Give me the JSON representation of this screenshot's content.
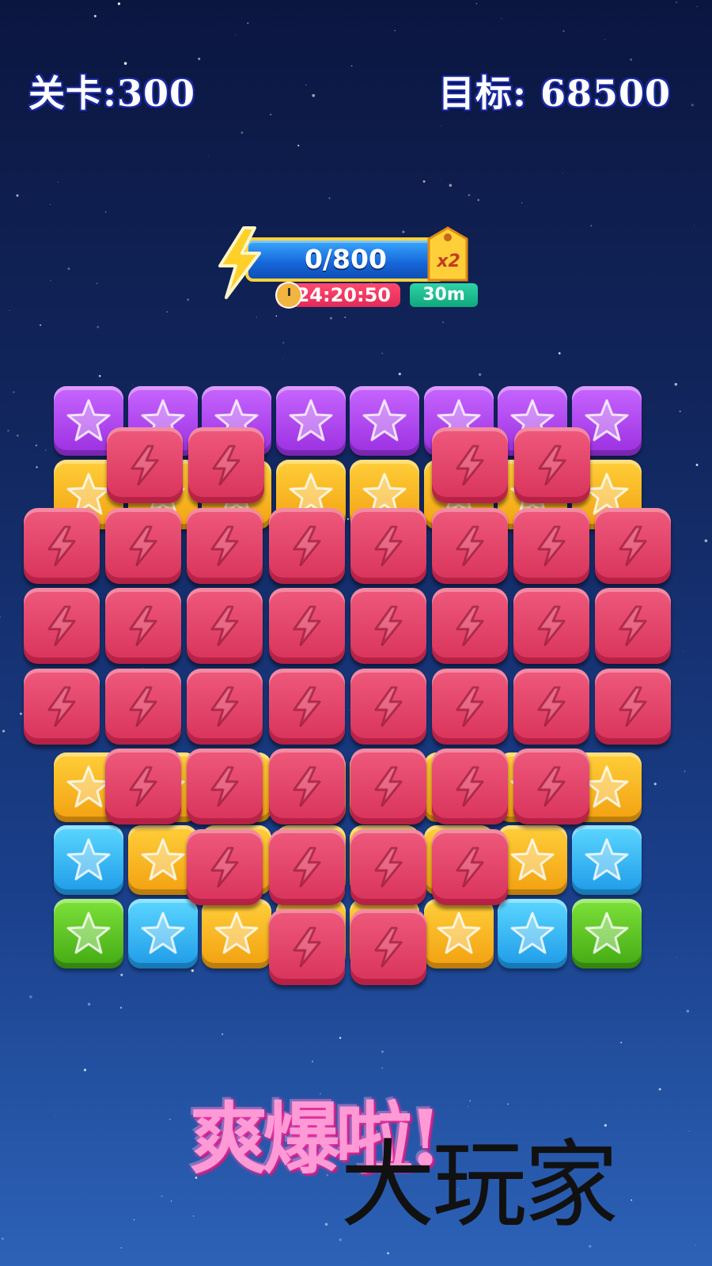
{
  "hud": {
    "level_text": "关卡:300",
    "target_text": "目标: 68500"
  },
  "energy": {
    "progress_text": "0/800",
    "progress_fraction": 0,
    "multiplier": "x2",
    "timer": "24:20:50",
    "duration": "30m",
    "icons": [
      "lightning-bolt-icon",
      "price-tag-icon",
      "clock-icon"
    ]
  },
  "board": {
    "columns": 8,
    "background_rows": [
      [
        "purple",
        "purple",
        "purple",
        "purple",
        "purple",
        "purple",
        "purple",
        "purple"
      ],
      [
        "orange",
        "orange",
        "orange",
        "orange",
        "orange",
        "orange",
        "orange",
        "orange"
      ],
      [
        "",
        "",
        "",
        "",
        "",
        "",
        "",
        ""
      ],
      [
        "",
        "",
        "",
        "",
        "",
        "",
        "",
        ""
      ],
      [
        "",
        "",
        "",
        "",
        "",
        "",
        "",
        ""
      ],
      [
        "orange",
        "orange",
        "orange",
        "orange",
        "orange",
        "orange",
        "orange",
        "orange"
      ],
      [
        "blue",
        "orange",
        "orange",
        "orange",
        "orange",
        "orange",
        "orange",
        "blue"
      ],
      [
        "green",
        "blue",
        "orange",
        "orange",
        "orange",
        "orange",
        "blue",
        "green"
      ]
    ],
    "heart_rows": [
      [
        0,
        1,
        1,
        0,
        0,
        1,
        1,
        0
      ],
      [
        1,
        1,
        1,
        1,
        1,
        1,
        1,
        1
      ],
      [
        1,
        1,
        1,
        1,
        1,
        1,
        1,
        1
      ],
      [
        1,
        1,
        1,
        1,
        1,
        1,
        1,
        1
      ],
      [
        0,
        1,
        1,
        1,
        1,
        1,
        1,
        0
      ],
      [
        0,
        0,
        1,
        1,
        1,
        1,
        0,
        0
      ],
      [
        0,
        0,
        0,
        1,
        1,
        0,
        0,
        0
      ]
    ],
    "colors": {
      "purple": "#b44bf2",
      "orange": "#f7b923",
      "blue": "#36b7f3",
      "green": "#5ec71f",
      "red": "#e4456b"
    }
  },
  "slogan": "爽爆啦!",
  "watermark": "大玩家"
}
